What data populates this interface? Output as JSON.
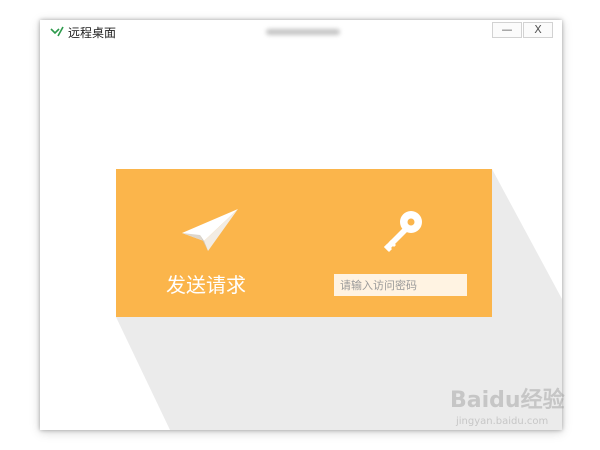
{
  "window": {
    "title": "远程桌面",
    "minimize_label": "—",
    "close_label": "X"
  },
  "panel": {
    "send_request_label": "发送请求",
    "password_placeholder": "请输入访问密码",
    "password_value": ""
  },
  "watermark": {
    "brand": "Baidu经验",
    "url": "jingyan.baidu.com"
  },
  "colors": {
    "panel": "#fbb54b",
    "long_shadow": "#ebebeb",
    "logo": "#2c9a4b"
  },
  "icons": {
    "logo": "app-logo-icon",
    "plane": "paper-plane-icon",
    "key": "key-icon"
  }
}
